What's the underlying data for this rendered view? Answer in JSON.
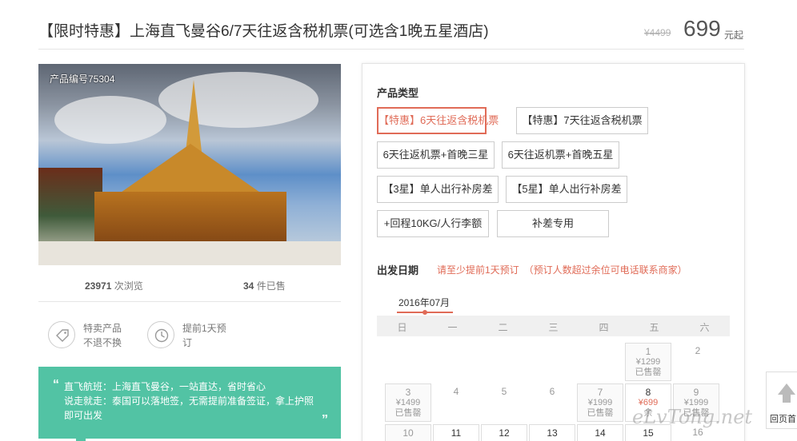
{
  "header": {
    "title": "【限时特惠】上海直飞曼谷6/7天往返含税机票(可选含1晚五星酒店)",
    "old_price": "¥4499",
    "price": "699",
    "price_unit": "元起"
  },
  "product": {
    "code": "产品编号75304",
    "views_count": "23971",
    "views_label": " 次浏览",
    "sold_count": "34",
    "sold_label": " 件已售"
  },
  "features": [
    {
      "icon": "tag-icon",
      "line1": "特卖产品",
      "line2": "不退不换"
    },
    {
      "icon": "clock-icon",
      "line1": "提前1天预",
      "line2": "订"
    }
  ],
  "quote": {
    "open": "“",
    "line1": "直飞航班：上海直飞曼谷，一站直达，省时省心",
    "line2": "说走就走：泰国可以落地签，无需提前准备签证，拿上护照",
    "line3": "即可出发",
    "close": "”"
  },
  "booking": {
    "type_label": "产品类型",
    "options": [
      "【特惠】6天往返含税机票",
      "【特惠】7天往返含税机票",
      "6天往返机票+首晚三星",
      "6天往返机票+首晚五星",
      "【3星】单人出行补房差",
      "【5星】单人出行补房差",
      "+回程10KG/人行李额",
      "补差专用"
    ],
    "date_label": "出发日期",
    "date_note": "请至少提前1天预订　（预订人数超过余位可电话联系商家）",
    "month": "2016年07月",
    "weekdays": [
      "日",
      "一",
      "二",
      "三",
      "四",
      "五",
      "六"
    ]
  },
  "calendar": {
    "c1": {
      "day": "1",
      "price": "¥1299",
      "status": "已售罄"
    },
    "c2": {
      "day": "2"
    },
    "c3": {
      "day": "3",
      "price": "¥1499",
      "status": "已售罄"
    },
    "c4": {
      "day": "4"
    },
    "c5": {
      "day": "5"
    },
    "c6": {
      "day": "6"
    },
    "c7": {
      "day": "7",
      "price": "¥1999",
      "status": "已售罄"
    },
    "c8": {
      "day": "8",
      "price": "¥699",
      "status": "余"
    },
    "c9": {
      "day": "9",
      "price": "¥1999",
      "status": "已售罄"
    },
    "c10": {
      "day": "10"
    },
    "c11": {
      "day": "11"
    },
    "c12": {
      "day": "12"
    },
    "c13": {
      "day": "13"
    },
    "c14": {
      "day": "14"
    },
    "c15": {
      "day": "15"
    },
    "c16": {
      "day": "16"
    }
  },
  "totop": {
    "label": "回页首"
  },
  "watermark": "eLvTong.net",
  "colors": {
    "accent": "#e06b57",
    "quote_bg": "#52c3a4"
  }
}
